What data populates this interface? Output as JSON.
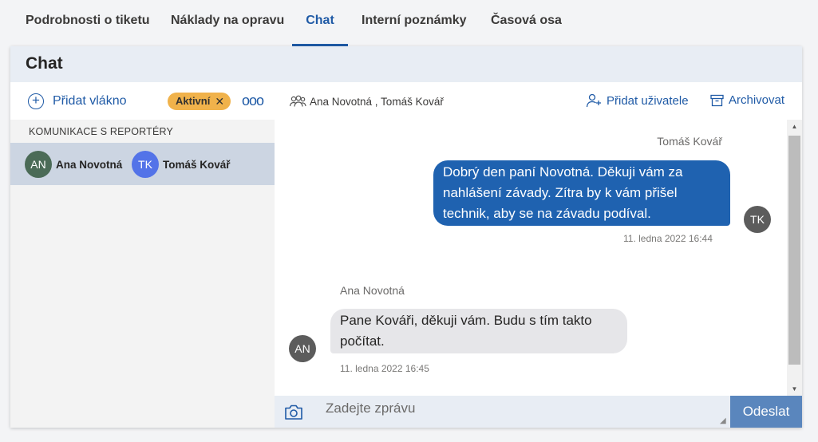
{
  "tabs": [
    {
      "label": "Podrobnosti o tiketu",
      "active": false
    },
    {
      "label": "Náklady na opravu",
      "active": false
    },
    {
      "label": "Chat",
      "active": true
    },
    {
      "label": "Interní poznámky",
      "active": false
    },
    {
      "label": "Časová osa",
      "active": false
    }
  ],
  "panel": {
    "title": "Chat"
  },
  "threads": {
    "add_label": "Přidat vlákno",
    "add_icon": "plus-circle-icon",
    "filter_badge": "Aktivní",
    "more_icon": "more-horizontal-icon",
    "section_label": "KOMUNIKACE S REPORTÉRY",
    "items": [
      {
        "users": [
          {
            "initials": "AN",
            "name": "Ana Novotná",
            "color": "#4b6b57"
          },
          {
            "initials": "TK",
            "name": "Tomáš Kovář",
            "color": "#5373e8"
          }
        ]
      }
    ]
  },
  "conversation": {
    "participants_icon": "people-icon",
    "participants": "Ana Novotná , Tomáš Kovář",
    "add_user_label": "Přidat uživatele",
    "add_user_icon": "person-add-icon",
    "archive_label": "Archivovat",
    "archive_icon": "archive-icon",
    "messages": [
      {
        "sender": "Tomáš Kovář",
        "initials": "TK",
        "direction": "outgoing",
        "line1": "Dobrý den paní Novotná. Děkuji vám za",
        "line2": "nahlášení závady. Zítra by k vám přišel",
        "line3": "technik, aby se na závadu podíval.",
        "timestamp": "11. ledna 2022 16:44"
      },
      {
        "sender": "Ana Novotná",
        "initials": "AN",
        "direction": "incoming",
        "line1": "Pane Kováři, děkuji vám. Budu s tím takto",
        "line2": "počítat.",
        "timestamp": "11. ledna 2022 16:45"
      }
    ]
  },
  "composer": {
    "placeholder": "Zadejte zprávu",
    "camera_icon": "camera-icon",
    "send_label": "Odeslat"
  },
  "colors": {
    "accent": "#1f5aa6",
    "outgoing_bubble": "#1f62b0",
    "incoming_bubble": "#e6e6e9",
    "badge": "#f0b24b",
    "send_button": "#5a86bd",
    "selected_thread": "#ccd5e2"
  }
}
